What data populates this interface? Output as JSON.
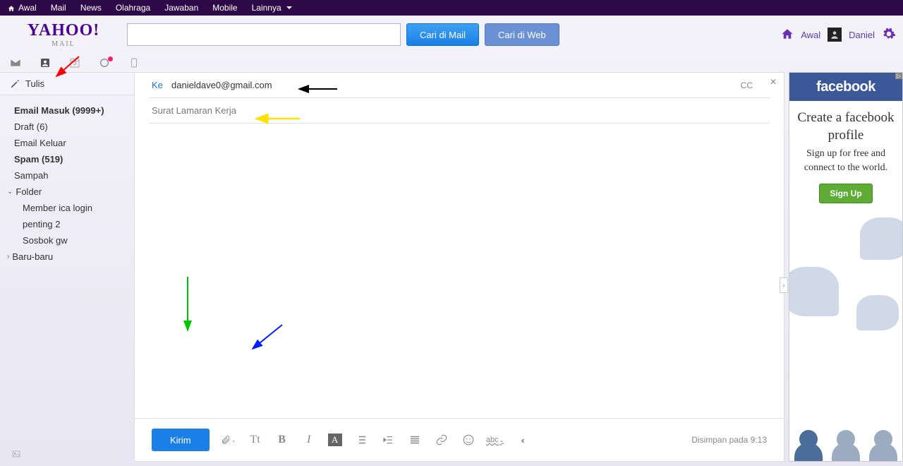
{
  "topnav": {
    "home": "Awal",
    "mail": "Mail",
    "news": "News",
    "sports": "Olahraga",
    "answers": "Jawaban",
    "mobile": "Mobile",
    "more": "Lainnya"
  },
  "logo": {
    "brand": "YAHOO!",
    "product": "MAIL"
  },
  "search": {
    "mail_btn": "Cari di Mail",
    "web_btn": "Cari di Web"
  },
  "user": {
    "home_label": "Awal",
    "name": "Daniel"
  },
  "iconrow": {
    "cal_day": "3"
  },
  "compose_label": "Tulis",
  "folders": {
    "inbox": "Email Masuk (9999+)",
    "draft": "Draft (6)",
    "sent": "Email Keluar",
    "spam": "Spam (519)",
    "trash": "Sampah",
    "folder_label": "Folder",
    "sub1": "Member ica login",
    "sub2": "penting 2",
    "sub3": "Sosbok gw",
    "recent": "Baru-baru"
  },
  "compose": {
    "to_label": "Ke",
    "to_value": "danieldave0@gmail.com",
    "cc_label": "CC",
    "subject": "Surat Lamaran Kerja",
    "send": "Kirim",
    "saved": "Disimpan pada 9:13",
    "abc": "abc"
  },
  "ad": {
    "brand": "facebook",
    "headline": "Create a facebook profile",
    "sub": "Sign up for free and connect to the world.",
    "cta": "Sign Up"
  }
}
